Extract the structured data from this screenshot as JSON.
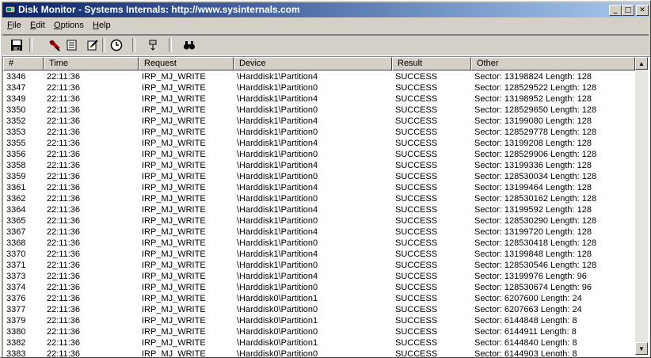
{
  "window": {
    "title": "Disk Monitor - Systems Internals: http://www.sysinternals.com",
    "controls": {
      "minimize": "_",
      "maximize": "□",
      "close": "✕"
    }
  },
  "menu": {
    "items": [
      {
        "label": "File",
        "underline": "F",
        "rest": "ile"
      },
      {
        "label": "Edit",
        "underline": "E",
        "rest": "dit"
      },
      {
        "label": "Options",
        "underline": "O",
        "rest": "ptions"
      },
      {
        "label": "Help",
        "underline": "H",
        "rest": "elp"
      }
    ]
  },
  "toolbar": {
    "buttons": [
      {
        "name": "save-icon"
      },
      {
        "name": "capture-icon"
      },
      {
        "name": "autoscroll-icon"
      },
      {
        "name": "clear-icon"
      },
      {
        "name": "clock-icon"
      },
      {
        "name": "filter-icon"
      },
      {
        "name": "find-icon"
      }
    ]
  },
  "table": {
    "columns": [
      "#",
      "Time",
      "Request",
      "Device",
      "Result",
      "Other"
    ],
    "rows": [
      [
        "3346",
        "22:11:36",
        "IRP_MJ_WRITE",
        "\\Harddisk1\\Partition4",
        "SUCCESS",
        "Sector: 13198824  Length: 128"
      ],
      [
        "3347",
        "22:11:36",
        "IRP_MJ_WRITE",
        "\\Harddisk1\\Partition0",
        "SUCCESS",
        "Sector: 128529522  Length: 128"
      ],
      [
        "3349",
        "22:11:36",
        "IRP_MJ_WRITE",
        "\\Harddisk1\\Partition4",
        "SUCCESS",
        "Sector: 13198952  Length: 128"
      ],
      [
        "3350",
        "22:11:36",
        "IRP_MJ_WRITE",
        "\\Harddisk1\\Partition0",
        "SUCCESS",
        "Sector: 128529650  Length: 128"
      ],
      [
        "3352",
        "22:11:36",
        "IRP_MJ_WRITE",
        "\\Harddisk1\\Partition4",
        "SUCCESS",
        "Sector: 13199080  Length: 128"
      ],
      [
        "3353",
        "22:11:36",
        "IRP_MJ_WRITE",
        "\\Harddisk1\\Partition0",
        "SUCCESS",
        "Sector: 128529778  Length: 128"
      ],
      [
        "3355",
        "22:11:36",
        "IRP_MJ_WRITE",
        "\\Harddisk1\\Partition4",
        "SUCCESS",
        "Sector: 13199208  Length: 128"
      ],
      [
        "3356",
        "22:11:36",
        "IRP_MJ_WRITE",
        "\\Harddisk1\\Partition0",
        "SUCCESS",
        "Sector: 128529906  Length: 128"
      ],
      [
        "3358",
        "22:11:36",
        "IRP_MJ_WRITE",
        "\\Harddisk1\\Partition4",
        "SUCCESS",
        "Sector: 13199336  Length: 128"
      ],
      [
        "3359",
        "22:11:36",
        "IRP_MJ_WRITE",
        "\\Harddisk1\\Partition0",
        "SUCCESS",
        "Sector: 128530034  Length: 128"
      ],
      [
        "3361",
        "22:11:36",
        "IRP_MJ_WRITE",
        "\\Harddisk1\\Partition4",
        "SUCCESS",
        "Sector: 13199464  Length: 128"
      ],
      [
        "3362",
        "22:11:36",
        "IRP_MJ_WRITE",
        "\\Harddisk1\\Partition0",
        "SUCCESS",
        "Sector: 128530162  Length: 128"
      ],
      [
        "3364",
        "22:11:36",
        "IRP_MJ_WRITE",
        "\\Harddisk1\\Partition4",
        "SUCCESS",
        "Sector: 13199592  Length: 128"
      ],
      [
        "3365",
        "22:11:36",
        "IRP_MJ_WRITE",
        "\\Harddisk1\\Partition0",
        "SUCCESS",
        "Sector: 128530290  Length: 128"
      ],
      [
        "3367",
        "22:11:36",
        "IRP_MJ_WRITE",
        "\\Harddisk1\\Partition4",
        "SUCCESS",
        "Sector: 13199720  Length: 128"
      ],
      [
        "3368",
        "22:11:36",
        "IRP_MJ_WRITE",
        "\\Harddisk1\\Partition0",
        "SUCCESS",
        "Sector: 128530418  Length: 128"
      ],
      [
        "3370",
        "22:11:36",
        "IRP_MJ_WRITE",
        "\\Harddisk1\\Partition4",
        "SUCCESS",
        "Sector: 13199848  Length: 128"
      ],
      [
        "3371",
        "22:11:36",
        "IRP_MJ_WRITE",
        "\\Harddisk1\\Partition0",
        "SUCCESS",
        "Sector: 128530546  Length: 128"
      ],
      [
        "3373",
        "22:11:36",
        "IRP_MJ_WRITE",
        "\\Harddisk1\\Partition4",
        "SUCCESS",
        "Sector: 13199976  Length: 96"
      ],
      [
        "3374",
        "22:11:36",
        "IRP_MJ_WRITE",
        "\\Harddisk1\\Partition0",
        "SUCCESS",
        "Sector: 128530674  Length: 96"
      ],
      [
        "3376",
        "22:11:36",
        "IRP_MJ_WRITE",
        "\\Harddisk0\\Partition1",
        "SUCCESS",
        "Sector: 6207600  Length: 24"
      ],
      [
        "3377",
        "22:11:36",
        "IRP_MJ_WRITE",
        "\\Harddisk0\\Partition0",
        "SUCCESS",
        "Sector: 6207663  Length: 24"
      ],
      [
        "3379",
        "22:11:36",
        "IRP_MJ_WRITE",
        "\\Harddisk0\\Partition1",
        "SUCCESS",
        "Sector: 6144848  Length: 8"
      ],
      [
        "3380",
        "22:11:36",
        "IRP_MJ_WRITE",
        "\\Harddisk0\\Partition0",
        "SUCCESS",
        "Sector: 6144911  Length: 8"
      ],
      [
        "3382",
        "22:11:36",
        "IRP_MJ_WRITE",
        "\\Harddisk0\\Partition1",
        "SUCCESS",
        "Sector: 6144840  Length: 8"
      ],
      [
        "3383",
        "22:11:36",
        "IRP_MJ_WRITE",
        "\\Harddisk0\\Partition0",
        "SUCCESS",
        "Sector: 6144903  Length: 8"
      ]
    ]
  },
  "scrollbar": {
    "up": "▲",
    "down": "▼"
  },
  "colors": {
    "title_start": "#0a246a",
    "title_end": "#a6caf0",
    "chrome": "#d4d0c8"
  }
}
